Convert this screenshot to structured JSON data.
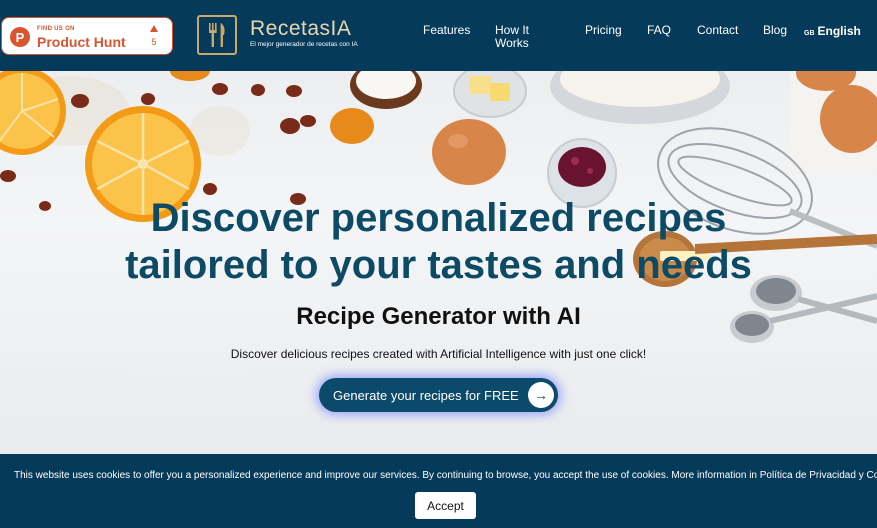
{
  "producthunt": {
    "small": "FIND US ON",
    "name": "Product Hunt",
    "logo": "P",
    "votes": "5"
  },
  "brand": {
    "name": "RecetasIA",
    "tagline": "El mejor generador de recetas con IA"
  },
  "nav": {
    "features": "Features",
    "how_it_works": "How It Works",
    "pricing": "Pricing",
    "faq": "FAQ",
    "contact": "Contact",
    "blog": "Blog",
    "language_flag": "GB",
    "language": "English"
  },
  "hero": {
    "headline_line1": "Discover personalized recipes",
    "headline_line2": "tailored to your tastes and needs",
    "subtitle": "Recipe Generator with AI",
    "lead": "Discover delicious recipes created with Artificial Intelligence with just one click!",
    "cta": "Generate your recipes for FREE",
    "cta_icon": "arrow-right-icon"
  },
  "cookie": {
    "text": "This website uses cookies to offer you a personalized experience and improve our services. By continuing to browse, you accept the use of cookies. More information in Política de Privacidad y Cookies",
    "accept": "Accept"
  },
  "colors": {
    "nav_bg": "#063a5a",
    "headline": "#0d4a66",
    "cta_bg": "#0b4a6a",
    "producthunt": "#da552f",
    "brand_gold": "#c9a96a"
  }
}
